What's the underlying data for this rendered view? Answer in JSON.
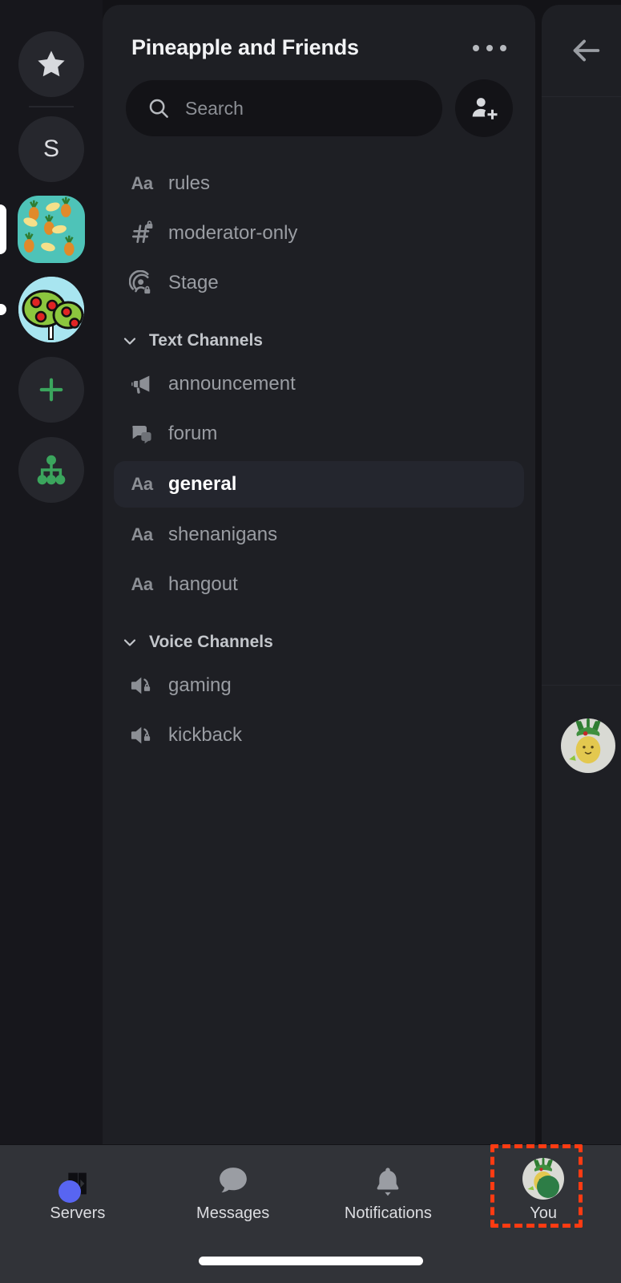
{
  "server_rail": {
    "items": [
      {
        "name": "favorites-star",
        "icon": "star-icon",
        "label": "",
        "type": "icon",
        "indicator": "none"
      },
      {
        "name": "server-s",
        "icon": "letter",
        "label": "S",
        "type": "letter",
        "indicator": "none"
      },
      {
        "name": "server-pineapple",
        "icon": "pineapple-pattern-icon",
        "label": "",
        "type": "image",
        "indicator": "selected"
      },
      {
        "name": "server-apple-tree",
        "icon": "apple-tree-icon",
        "label": "",
        "type": "image",
        "indicator": "unread"
      },
      {
        "name": "add-server",
        "icon": "plus-icon",
        "label": "",
        "type": "icon",
        "indicator": "none"
      },
      {
        "name": "explore-servers",
        "icon": "hierarchy-icon",
        "label": "",
        "type": "icon",
        "indicator": "none"
      }
    ]
  },
  "panel": {
    "title": "Pineapple and Friends",
    "more_menu": "overflow-menu",
    "search": {
      "placeholder": "Search",
      "value": ""
    },
    "invite_button": "add-member-icon"
  },
  "channels": {
    "ungrouped": [
      {
        "name": "rules",
        "icon": "aa-icon",
        "icon_text": "Aa",
        "selected": false
      },
      {
        "name": "moderator-only",
        "icon": "hash-lock-icon",
        "icon_text": "",
        "selected": false
      },
      {
        "name": "Stage",
        "icon": "stage-lock-icon",
        "icon_text": "",
        "selected": false
      }
    ],
    "groups": [
      {
        "label": "Text Channels",
        "collapsed": false,
        "items": [
          {
            "name": "announcement",
            "icon": "megaphone-icon",
            "icon_text": "",
            "selected": false
          },
          {
            "name": "forum",
            "icon": "forum-icon",
            "icon_text": "",
            "selected": false
          },
          {
            "name": "general",
            "icon": "aa-icon",
            "icon_text": "Aa",
            "selected": true
          },
          {
            "name": "shenanigans",
            "icon": "aa-icon",
            "icon_text": "Aa",
            "selected": false
          },
          {
            "name": "hangout",
            "icon": "aa-icon",
            "icon_text": "Aa",
            "selected": false
          }
        ]
      },
      {
        "label": "Voice Channels",
        "collapsed": false,
        "items": [
          {
            "name": "gaming",
            "icon": "speaker-lock-icon",
            "icon_text": "",
            "selected": false
          },
          {
            "name": "kickback",
            "icon": "speaker-lock-icon",
            "icon_text": "",
            "selected": false
          }
        ]
      }
    ]
  },
  "right_peek": {
    "back_button": "back-arrow-icon",
    "avatar": "pineapple-avatar"
  },
  "bottom_nav": {
    "items": [
      {
        "label": "Servers",
        "icon": "servers-icon",
        "badge": "blue-dot",
        "active": true
      },
      {
        "label": "Messages",
        "icon": "chat-bubble-icon",
        "badge": "",
        "active": false
      },
      {
        "label": "Notifications",
        "icon": "bell-icon",
        "badge": "",
        "active": false
      },
      {
        "label": "You",
        "icon": "user-avatar-icon",
        "badge": "online-status",
        "active": false
      }
    ]
  },
  "colors": {
    "rail_bg": "#17171c",
    "panel_bg": "#1e1f24",
    "selected_row": "#24262e",
    "nav_bg": "#313338",
    "accent_green": "#3ba55d",
    "badge_blue": "#5865f2",
    "status_green": "#2d7d46",
    "highlight_red": "#ff3b12",
    "text_primary": "#f2f3f5",
    "text_muted": "#9a9da3"
  }
}
